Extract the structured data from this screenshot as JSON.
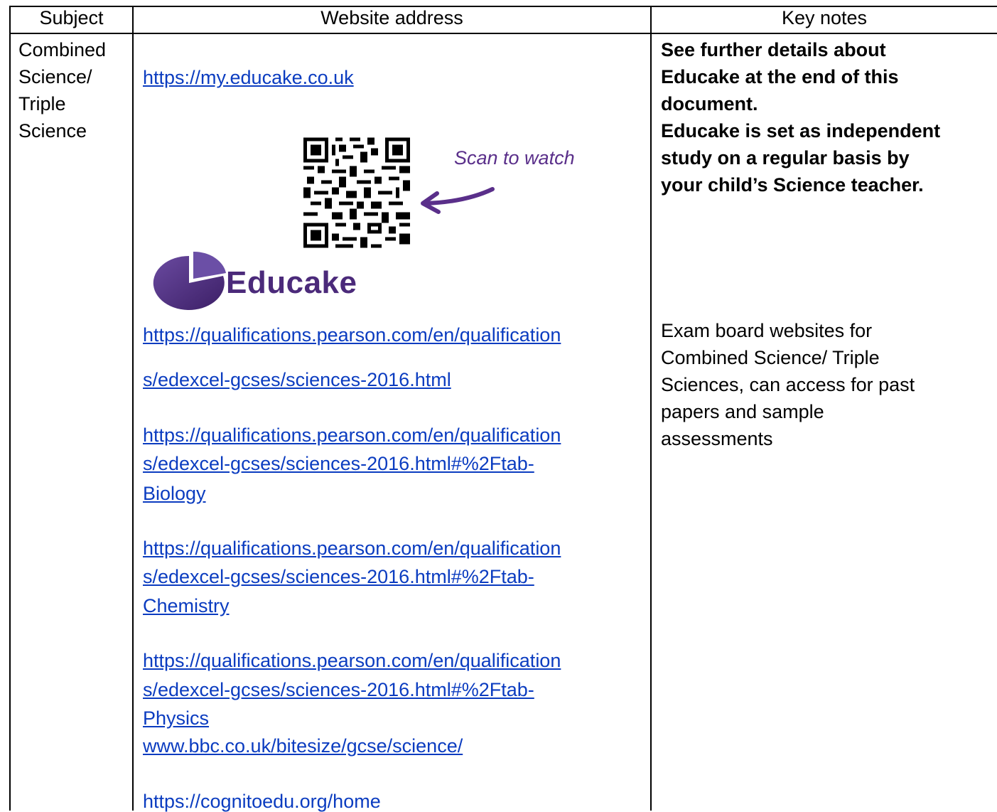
{
  "header": {
    "columns": [
      "Subject",
      "Website address",
      "Key notes"
    ]
  },
  "row": {
    "subject_lines": [
      "Combined",
      "Science/",
      "Triple",
      "Science"
    ],
    "links": [
      {
        "lines": [
          "https://my.educake.co.uk"
        ]
      },
      {
        "lines": [
          "https://qualifications.pearson.com/en/qualification",
          "s/edexcel-gcses/sciences-2016.html"
        ]
      },
      {
        "lines": [
          "https://qualifications.pearson.com/en/qualification",
          "s/edexcel-gcses/sciences-2016.html#%2Ftab-",
          "Biology"
        ]
      },
      {
        "lines": [
          "https://qualifications.pearson.com/en/qualification",
          "s/edexcel-gcses/sciences-2016.html#%2Ftab-",
          "Chemistry"
        ]
      },
      {
        "lines": [
          "https://qualifications.pearson.com/en/qualification",
          "s/edexcel-gcses/sciences-2016.html#%2Ftab-",
          "Physics"
        ]
      },
      {
        "lines": [
          "www.bbc.co.uk/bitesize/gcse/science/"
        ]
      },
      {
        "lines": [
          "https://cognitoedu.org/home"
        ]
      }
    ],
    "qr": {
      "caption": "Scan to watch",
      "icon": "qr-code-icon"
    },
    "logo": {
      "text": "Educake",
      "icon": "educake-pie-icon",
      "color": "#4b2a7a"
    },
    "notes_bold": [
      "See further details about",
      "Educake at the end of this",
      "document.",
      "Educake is set as independent",
      "study on a regular basis by",
      "your child’s Science teacher."
    ],
    "notes_plain": [
      "Exam board websites for",
      "Combined Science/ Triple",
      "Sciences, can access for past",
      "papers and sample",
      "assessments"
    ]
  },
  "colors": {
    "link": "#0b3cc0",
    "accent_purple": "#5a2f8a"
  }
}
